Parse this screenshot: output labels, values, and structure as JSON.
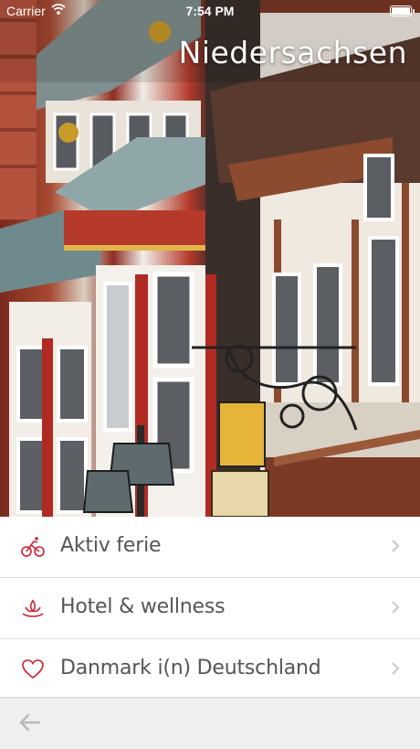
{
  "status_bar": {
    "carrier": "Carrier",
    "time": "7:54 PM",
    "wifi_icon": "wifi-icon",
    "battery_icon": "battery-icon"
  },
  "header": {
    "title": "Niedersachsen",
    "image": "half-timbered-houses-photo"
  },
  "menu": {
    "items": [
      {
        "label": "Aktiv ferie",
        "icon": "bicycle-icon"
      },
      {
        "label": "Hotel & wellness",
        "icon": "spa-lotus-icon"
      },
      {
        "label": "Danmark i(n) Deutschland",
        "icon": "heart-icon"
      }
    ],
    "chevron_icon": "chevron-right-icon",
    "accent_color": "#d0202e"
  },
  "bottom_bar": {
    "back_icon": "back-arrow-icon"
  }
}
